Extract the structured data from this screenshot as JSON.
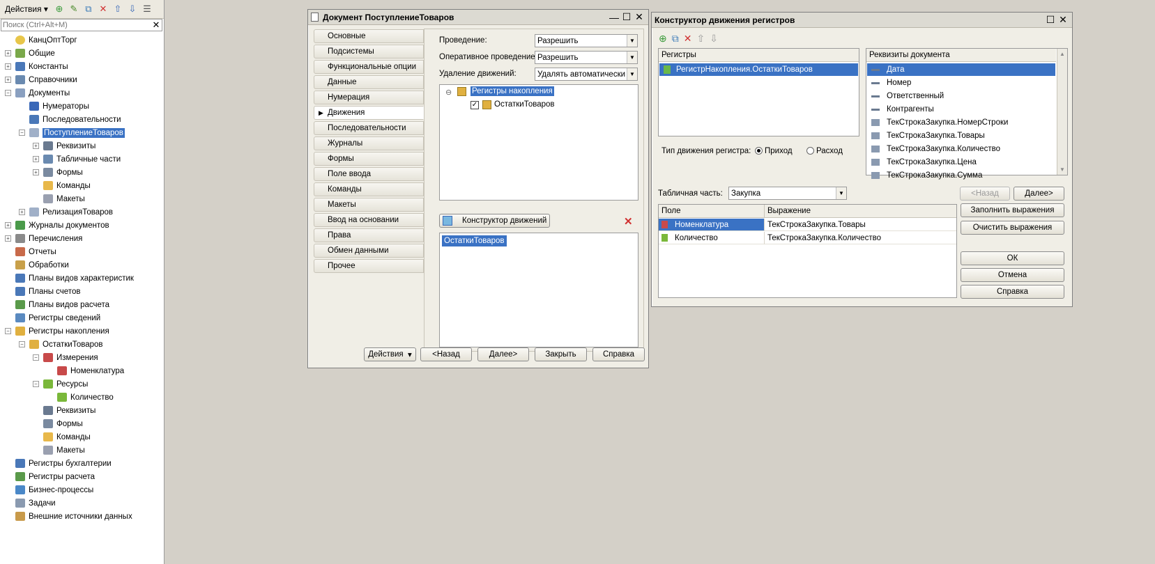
{
  "left": {
    "menu_label": "Действия",
    "search_placeholder": "Поиск (Ctrl+Alt+M)",
    "tree": [
      {
        "label": "КанцОптТорг",
        "icon": "config-icon",
        "color": "#e8c64a",
        "level": 0,
        "expander": ""
      },
      {
        "label": "Общие",
        "icon": "common-icon",
        "color": "#7aa84a",
        "level": 0,
        "expander": "+"
      },
      {
        "label": "Константы",
        "icon": "constants-icon",
        "color": "#4a78b8",
        "level": 0,
        "expander": "+"
      },
      {
        "label": "Справочники",
        "icon": "catalogs-icon",
        "color": "#6a8ab0",
        "level": 0,
        "expander": "+"
      },
      {
        "label": "Документы",
        "icon": "documents-icon",
        "color": "#8aa0c0",
        "level": 0,
        "expander": "−"
      },
      {
        "label": "Нумераторы",
        "icon": "numerators-icon",
        "color": "#3a68b8",
        "level": 1,
        "expander": ""
      },
      {
        "label": "Последовательности",
        "icon": "sequences-icon",
        "color": "#4a78b8",
        "level": 1,
        "expander": ""
      },
      {
        "label": "ПоступлениеТоваров",
        "icon": "document-icon",
        "color": "#a0b0c8",
        "level": 1,
        "expander": "−",
        "selected": true
      },
      {
        "label": "Реквизиты",
        "icon": "attributes-icon",
        "color": "#6a7a90",
        "level": 2,
        "expander": "+"
      },
      {
        "label": "Табличные части",
        "icon": "tabular-icon",
        "color": "#6a8ab0",
        "level": 2,
        "expander": "+"
      },
      {
        "label": "Формы",
        "icon": "forms-icon",
        "color": "#7a8aa0",
        "level": 2,
        "expander": "+"
      },
      {
        "label": "Команды",
        "icon": "commands-icon",
        "color": "#e8b84a",
        "level": 2,
        "expander": ""
      },
      {
        "label": "Макеты",
        "icon": "templates-icon",
        "color": "#9aa0b0",
        "level": 2,
        "expander": ""
      },
      {
        "label": "РелизацияТоваров",
        "icon": "document-icon",
        "color": "#a0b0c8",
        "level": 1,
        "expander": "+"
      },
      {
        "label": "Журналы документов",
        "icon": "journals-icon",
        "color": "#4a9a4a",
        "level": 0,
        "expander": "+"
      },
      {
        "label": "Перечисления",
        "icon": "enums-icon",
        "color": "#8a8a8a",
        "level": 0,
        "expander": "+"
      },
      {
        "label": "Отчеты",
        "icon": "reports-icon",
        "color": "#c86a4a",
        "level": 0,
        "expander": ""
      },
      {
        "label": "Обработки",
        "icon": "processing-icon",
        "color": "#c8a04a",
        "level": 0,
        "expander": ""
      },
      {
        "label": "Планы видов характеристик",
        "icon": "chart-types-icon",
        "color": "#4a78b8",
        "level": 0,
        "expander": ""
      },
      {
        "label": "Планы счетов",
        "icon": "accounts-icon",
        "color": "#4a78b8",
        "level": 0,
        "expander": ""
      },
      {
        "label": "Планы видов расчета",
        "icon": "calc-types-icon",
        "color": "#5a9a4a",
        "level": 0,
        "expander": ""
      },
      {
        "label": "Регистры сведений",
        "icon": "info-registers-icon",
        "color": "#5a8ac0",
        "level": 0,
        "expander": ""
      },
      {
        "label": "Регистры накопления",
        "icon": "accum-registers-icon",
        "color": "#e0b040",
        "level": 0,
        "expander": "−"
      },
      {
        "label": "ОстаткиТоваров",
        "icon": "register-icon",
        "color": "#e0b040",
        "level": 1,
        "expander": "−"
      },
      {
        "label": "Измерения",
        "icon": "dimensions-icon",
        "color": "#c84a4a",
        "level": 2,
        "expander": "−"
      },
      {
        "label": "Номенклатура",
        "icon": "dimension-icon",
        "color": "#c84a4a",
        "level": 3,
        "expander": ""
      },
      {
        "label": "Ресурсы",
        "icon": "resources-icon",
        "color": "#7ab83a",
        "level": 2,
        "expander": "−"
      },
      {
        "label": "Количество",
        "icon": "resource-icon",
        "color": "#7ab83a",
        "level": 3,
        "expander": ""
      },
      {
        "label": "Реквизиты",
        "icon": "attributes-icon",
        "color": "#6a7a90",
        "level": 2,
        "expander": ""
      },
      {
        "label": "Формы",
        "icon": "forms-icon",
        "color": "#7a8aa0",
        "level": 2,
        "expander": ""
      },
      {
        "label": "Команды",
        "icon": "commands-icon",
        "color": "#e8b84a",
        "level": 2,
        "expander": ""
      },
      {
        "label": "Макеты",
        "icon": "templates-icon",
        "color": "#9aa0b0",
        "level": 2,
        "expander": ""
      },
      {
        "label": "Регистры бухгалтерии",
        "icon": "acc-registers-icon",
        "color": "#4a78b8",
        "level": 0,
        "expander": ""
      },
      {
        "label": "Регистры расчета",
        "icon": "calc-registers-icon",
        "color": "#5a9a4a",
        "level": 0,
        "expander": ""
      },
      {
        "label": "Бизнес-процессы",
        "icon": "bp-icon",
        "color": "#4a88c8",
        "level": 0,
        "expander": ""
      },
      {
        "label": "Задачи",
        "icon": "tasks-icon",
        "color": "#8a9ab0",
        "level": 0,
        "expander": ""
      },
      {
        "label": "Внешние источники данных",
        "icon": "external-icon",
        "color": "#c89a4a",
        "level": 0,
        "expander": ""
      }
    ]
  },
  "doc": {
    "title": "Документ ПоступлениеТоваров",
    "tabs": [
      "Основные",
      "Подсистемы",
      "Функциональные опции",
      "Данные",
      "Нумерация",
      "Движения",
      "Последовательности",
      "Журналы",
      "Формы",
      "Поле ввода",
      "Команды",
      "Макеты",
      "Ввод на основании",
      "Права",
      "Обмен данными",
      "Прочее"
    ],
    "active_tab": "Движения",
    "posting_label": "Проведение:",
    "posting_value": "Разрешить",
    "realtime_label": "Оперативное проведение:",
    "realtime_value": "Разрешить",
    "deletion_label": "Удаление движений:",
    "deletion_value": "Удалять автоматически п",
    "reg_tree_root": "Регистры накопления",
    "reg_tree_child": "ОстаткиТоваров",
    "constructor_button": "Конструктор движений",
    "movements_item": "ОстаткиТоваров",
    "buttons": {
      "actions": "Действия",
      "back": "<Назад",
      "next": "Далее>",
      "close": "Закрыть",
      "help": "Справка"
    }
  },
  "wiz": {
    "title": "Конструктор движения регистров",
    "registers_header": "Регистры",
    "register_item": "РегистрНакопления.ОстаткиТоваров",
    "requisites_header": "Реквизиты документа",
    "requisites": [
      "Дата",
      "Номер",
      "Ответственный",
      "Контрагенты",
      "ТекСтрокаЗакупка.НомерСтроки",
      "ТекСтрокаЗакупка.Товары",
      "ТекСтрокаЗакупка.Количество",
      "ТекСтрокаЗакупка.Цена",
      "ТекСтрокаЗакупка.Сумма"
    ],
    "movement_type_label": "Тип движения регистра:",
    "income_label": "Приход",
    "expense_label": "Расход",
    "tabular_label": "Табличная часть:",
    "tabular_value": "Закупка",
    "col_field": "Поле",
    "col_expr": "Выражение",
    "rows": [
      {
        "field": "Номенклатура",
        "expr": "ТекСтрокаЗакупка.Товары"
      },
      {
        "field": "Количество",
        "expr": "ТекСтрокаЗакупка.Количество"
      }
    ],
    "buttons": {
      "back": "<Назад",
      "next": "Далее>",
      "fill": "Заполнить выражения",
      "clear": "Очистить выражения",
      "ok": "ОК",
      "cancel": "Отмена",
      "help": "Справка"
    }
  },
  "colors": {
    "selection": "#3a72c4",
    "desktop": "#d4d0c8",
    "window_bg": "#f0eee6"
  }
}
